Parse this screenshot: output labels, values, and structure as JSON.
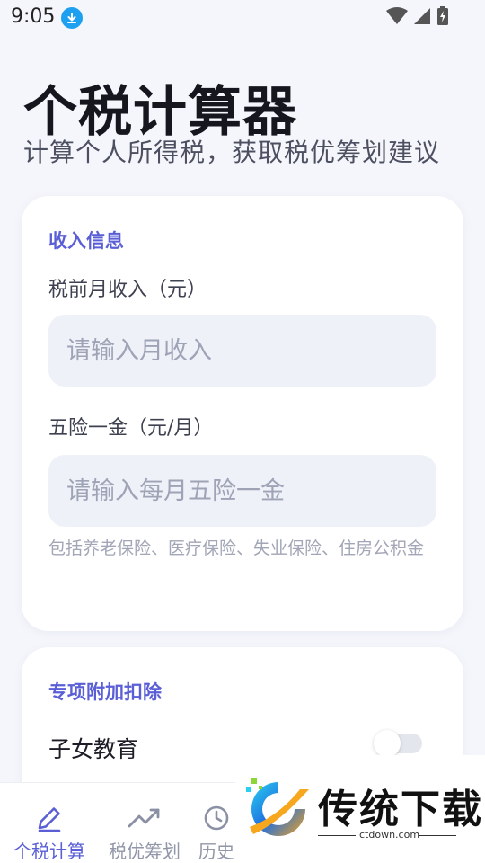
{
  "status_bar": {
    "time": "9:05",
    "icons": [
      "download-icon",
      "wifi-icon",
      "cell-signal-icon",
      "battery-charging-icon"
    ]
  },
  "header": {
    "title": "个税计算器",
    "subtitle": "计算个人所得税，获取税优筹划建议"
  },
  "income_card": {
    "section_title": "收入信息",
    "monthly_income": {
      "label": "税前月收入（元）",
      "value": "",
      "placeholder": "请输入月收入"
    },
    "social_insurance": {
      "label": "五险一金（元/月）",
      "value": "",
      "placeholder": "请输入每月五险一金"
    },
    "hint": "包括养老保险、医疗保险、失业保险、住房公积金"
  },
  "deduction_card": {
    "section_title": "专项附加扣除",
    "items": [
      {
        "label": "子女教育",
        "enabled": false
      }
    ]
  },
  "bottom_nav": {
    "items": [
      {
        "label": "个税计算",
        "icon": "pencil-icon",
        "active": true
      },
      {
        "label": "税优筹划",
        "icon": "trend-up-icon",
        "active": false
      },
      {
        "label": "历史",
        "icon": "history-icon",
        "active": false
      }
    ]
  },
  "watermark": {
    "text": "传统下载",
    "url": "ctdown.com"
  },
  "colors": {
    "accent": "#5b5fd6",
    "background": "#f5f6fb",
    "input_bg": "#eff1f8"
  }
}
